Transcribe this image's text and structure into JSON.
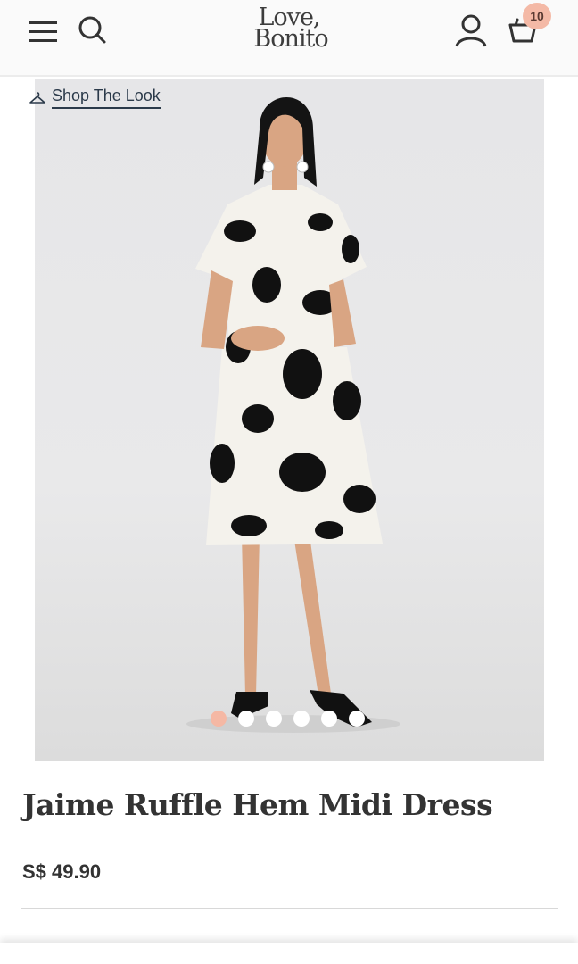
{
  "header": {
    "logo_line1": "Love,",
    "logo_line2": "Bonito",
    "cart_count": "10",
    "icons": [
      "menu-icon",
      "search-icon",
      "account-icon",
      "cart-icon"
    ]
  },
  "gallery": {
    "shop_the_look_label": "Shop The Look",
    "image_description": "Model wearing black and white floral ruffle hem midi dress",
    "slide_count": 6,
    "active_slide": 1
  },
  "product": {
    "title": "Jaime Ruffle Hem Midi Dress",
    "price": "S$ 49.90"
  },
  "colors": {
    "accent": "#f5b8a4",
    "text": "#333333",
    "link": "#2b3a4a"
  }
}
